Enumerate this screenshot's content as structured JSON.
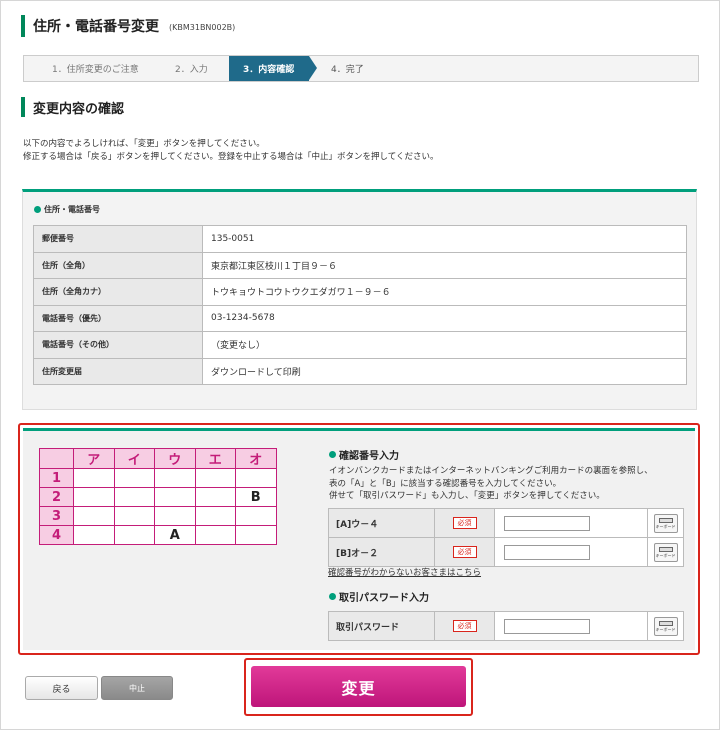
{
  "header": {
    "title": "住所・電話番号変更",
    "code": "(KBM31BN002B)"
  },
  "steps": [
    {
      "label": "1．住所変更のご注意"
    },
    {
      "label": "2．入力"
    },
    {
      "label": "3．内容確認"
    },
    {
      "label": "4．完了"
    }
  ],
  "section": {
    "title": "変更内容の確認"
  },
  "intro": {
    "line1": "以下の内容でよろしければ、「変更」ボタンを押してください。",
    "line2": "修正する場合は「戻る」ボタンを押してください。登録を中止する場合は「中止」ボタンを押してください。"
  },
  "info": {
    "heading": "住所・電話番号",
    "rows": [
      {
        "key": "郵便番号",
        "value": "135-0051"
      },
      {
        "key": "住所（全角）",
        "value": "東京都江東区枝川１丁目９－６"
      },
      {
        "key": "住所（全角カナ）",
        "value": "トウキョウトコウトウクエダガワ１－９－６"
      },
      {
        "key": "電話番号（優先）",
        "value": "03-1234-5678"
      },
      {
        "key": "電話番号（その他）",
        "value": "（変更なし）"
      },
      {
        "key": "住所変更届",
        "value": "ダウンロードして印刷"
      }
    ]
  },
  "card": {
    "columns": [
      "ア",
      "イ",
      "ウ",
      "エ",
      "オ"
    ],
    "rows": [
      {
        "label": "1",
        "cells": [
          "",
          "",
          "",
          "",
          ""
        ]
      },
      {
        "label": "2",
        "cells": [
          "",
          "",
          "",
          "",
          "B"
        ]
      },
      {
        "label": "3",
        "cells": [
          "",
          "",
          "",
          "",
          ""
        ]
      },
      {
        "label": "4",
        "cells": [
          "",
          "",
          "A",
          "",
          ""
        ]
      }
    ]
  },
  "confirm": {
    "heading": "確認番号入力",
    "desc1": "イオンバンクカードまたはインターネットバンキングご利用カードの裏面を参照し、",
    "desc2": "表の「A」と「B」に該当する確認番号を入力してください。",
    "desc3": "併せて「取引パスワード」も入力し、「変更」ボタンを押してください。",
    "fieldA": {
      "label": "[A]ウ－４",
      "value": ""
    },
    "fieldB": {
      "label": "[B]オ－２",
      "value": ""
    },
    "required": "必須",
    "keyboard": "キーボード",
    "help_link": "確認番号がわからないお客さまはこちら"
  },
  "password": {
    "heading": "取引パスワード入力",
    "label": "取引パスワード",
    "value": ""
  },
  "buttons": {
    "back": "戻る",
    "cancel": "中止",
    "change": "変更"
  },
  "colors": {
    "accent": "#009f7c",
    "primary": "#c41d79",
    "alert": "#d9251c",
    "step_active": "#1f6a8a"
  }
}
